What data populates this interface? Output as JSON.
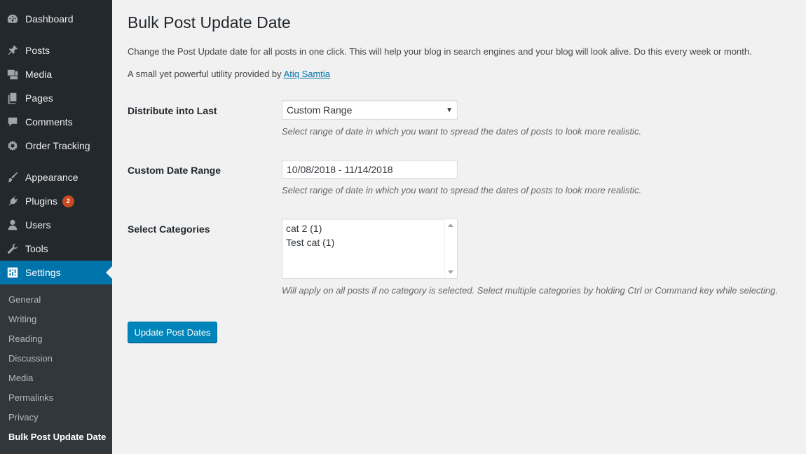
{
  "sidebar": {
    "items": [
      {
        "label": "Dashboard",
        "icon": "dashboard-icon"
      },
      {
        "label": "Posts",
        "icon": "pin-icon"
      },
      {
        "label": "Media",
        "icon": "media-icon"
      },
      {
        "label": "Pages",
        "icon": "pages-icon"
      },
      {
        "label": "Comments",
        "icon": "comment-icon"
      },
      {
        "label": "Order Tracking",
        "icon": "gear-icon"
      },
      {
        "label": "Appearance",
        "icon": "brush-icon"
      },
      {
        "label": "Plugins",
        "icon": "plug-icon",
        "badge": "2"
      },
      {
        "label": "Users",
        "icon": "user-icon"
      },
      {
        "label": "Tools",
        "icon": "wrench-icon"
      },
      {
        "label": "Settings",
        "icon": "settings-sliders-icon"
      }
    ],
    "submenu": [
      "General",
      "Writing",
      "Reading",
      "Discussion",
      "Media",
      "Permalinks",
      "Privacy",
      "Bulk Post Update Date"
    ]
  },
  "page": {
    "title": "Bulk Post Update Date",
    "description": "Change the Post Update date for all posts in one click. This will help your blog in search engines and your blog will look alive. Do this every week or month.",
    "credit_prefix": "A small yet powerful utility provided by",
    "credit_link": "Atiq Samtia"
  },
  "form": {
    "distribute": {
      "label": "Distribute into Last",
      "value": "Custom Range",
      "help": "Select range of date in which you want to spread the dates of posts to look more realistic."
    },
    "date_range": {
      "label": "Custom Date Range",
      "value": "10/08/2018 - 11/14/2018",
      "help": "Select range of date in which you want to spread the dates of posts to look more realistic."
    },
    "categories": {
      "label": "Select Categories",
      "options": [
        "cat 2 (1)",
        "Test cat (1)"
      ],
      "help": "Will apply on all posts if no category is selected. Select multiple categories by holding Ctrl or Command key while selecting."
    },
    "submit_label": "Update Post Dates"
  },
  "colors": {
    "sidebar_bg": "#23282d",
    "submenu_bg": "#32373c",
    "accent": "#0073aa",
    "button": "#0085ba",
    "badge": "#ca4a1f",
    "content_bg": "#f1f1f1"
  }
}
